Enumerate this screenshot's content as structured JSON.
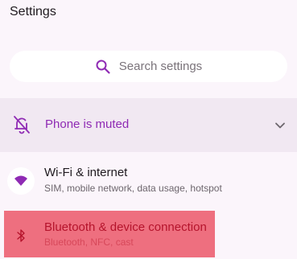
{
  "header": {
    "title": "Settings"
  },
  "search": {
    "placeholder": "Search settings",
    "icon": "search-icon"
  },
  "muted_banner": {
    "label": "Phone is muted",
    "icon": "bell-off-icon",
    "chevron": "chevron-down-icon"
  },
  "settings": [
    {
      "title": "Wi-Fi & internet",
      "subtitle": "SIM, mobile network, data usage, hotspot",
      "icon": "wifi-icon"
    },
    {
      "title": "Bluetooth & device connection",
      "subtitle": "Bluetooth, NFC, cast",
      "icon": "bluetooth-icon"
    }
  ],
  "colors": {
    "accent": "#8f2bb4",
    "background": "#fbf5fb",
    "banner": "#f1e8f2",
    "highlight": "#ee6f7f"
  }
}
